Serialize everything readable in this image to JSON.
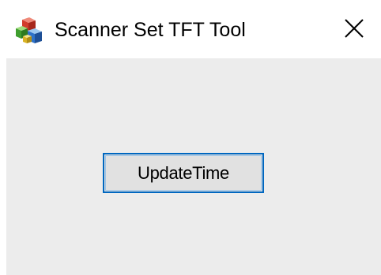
{
  "window": {
    "title": "Scanner Set TFT Tool",
    "icon": "app-cubes-icon",
    "close_icon": "close-icon"
  },
  "main": {
    "update_button_label": "UpdateTime"
  },
  "colors": {
    "client_background": "#ececec",
    "button_face": "#e1e1e1",
    "button_focus_border": "#0067c0"
  }
}
